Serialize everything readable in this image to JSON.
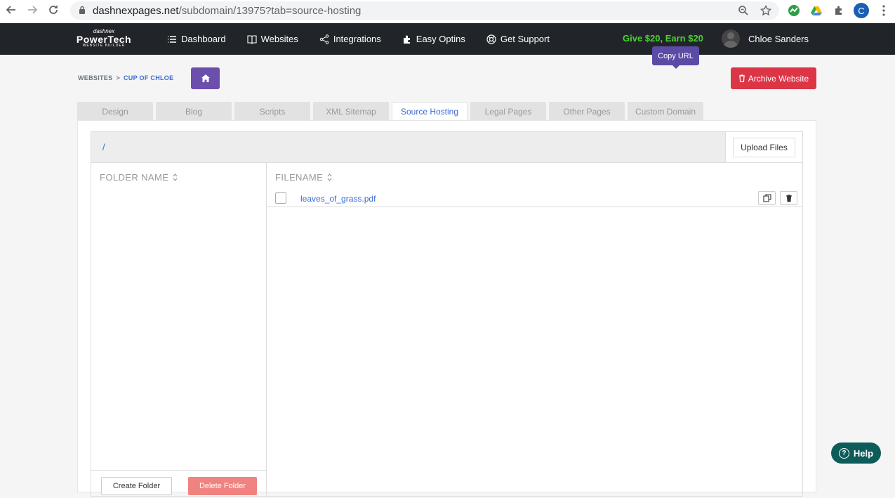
{
  "browser": {
    "url_host": "dashnexpages.net",
    "url_path": "/subdomain/13975?tab=source-hosting",
    "profile_initial": "C"
  },
  "logo": {
    "line1": "dashnex",
    "line2": "PowerTech",
    "line3": "WEBSITE BUILDER"
  },
  "nav": {
    "items": [
      {
        "label": "Dashboard",
        "icon": "list-icon"
      },
      {
        "label": "Websites",
        "icon": "book-icon"
      },
      {
        "label": "Integrations",
        "icon": "share-icon"
      },
      {
        "label": "Easy Optins",
        "icon": "puzzle-icon"
      },
      {
        "label": "Get Support",
        "icon": "lifebuoy-icon"
      }
    ],
    "promo": "Give $20, Earn $20",
    "user_name": "Chloe Sanders"
  },
  "breadcrumb": {
    "parent": "WEBSITES",
    "separator": ">",
    "current": "CUP OF CHLOE"
  },
  "archive_label": "Archive Website",
  "tabs": [
    {
      "label": "Design",
      "active": false
    },
    {
      "label": "Blog",
      "active": false
    },
    {
      "label": "Scripts",
      "active": false
    },
    {
      "label": "XML Sitemap",
      "active": false
    },
    {
      "label": "Source Hosting",
      "active": true
    },
    {
      "label": "Legal Pages",
      "active": false
    },
    {
      "label": "Other Pages",
      "active": false
    },
    {
      "label": "Custom Domain",
      "active": false
    }
  ],
  "file_manager": {
    "path": "/",
    "upload_label": "Upload Files",
    "folder_header": "FOLDER NAME",
    "file_header": "FILENAME",
    "files": [
      {
        "name": "leaves_of_grass.pdf"
      }
    ],
    "tooltip": "Copy URL",
    "create_folder_label": "Create Folder",
    "delete_folder_label": "Delete Folder"
  },
  "help_label": "Help",
  "colors": {
    "navbar": "#212529",
    "accent_purple": "#6c4fad",
    "danger": "#dc3545",
    "promo_green": "#4cd137",
    "link_blue": "#3b6bd9",
    "help_teal": "#0d5c5a"
  }
}
